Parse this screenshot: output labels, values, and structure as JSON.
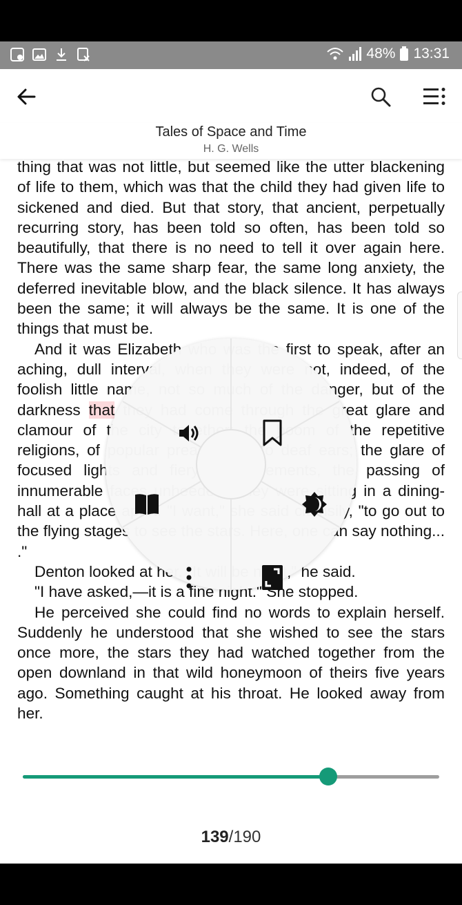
{
  "status_bar": {
    "battery": "48%",
    "time": "13:31"
  },
  "book": {
    "title": "Tales of Space and Time",
    "author": "H. G. Wells"
  },
  "content": {
    "p1": "thing that was not little, but seemed like the utter blackening of life to them, which was that the child they had given life to sickened and died. But that story, that ancient, perpetually recurring story, has been told so often, has been told so beautifully, that there is no need to tell it over again here. There was the same sharp fear, the same long anxiety, the deferred inevitable blow, and the black silence. It has always been the same; it will always be the same. It is one of the things that must be.",
    "p2_a": "And it was Elizabeth who was the first to speak, after an aching, dull interval, when they were not, indeed, of the foolish little name, not so much of the danger, but of the darkness ",
    "p2_hl": "that",
    "p2_b": " they had come through the great glare and clamour of the city together; the boom of the repetitive religions, of popular preachers unto deaf ears; the glare of focused lights and fiery advertisements, the passing of innumerable faces unheeded. They were sitting in a dining-hall at a place apart. \"I want,\" she said clumsily, \"to go out to the flying stages to see the stars. Here, one can say nothing... .\"",
    "p3": "Denton looked at her. \"It will be night,\" he said.",
    "p4": "\"I have asked,—it is a fine night.\" She stopped.",
    "p5": "He perceived she could find no words to explain herself. Suddenly he understood that she wished to see the stars once more, the stars they had watched together from the open downland in that wild honeymoon of theirs five years ago. Something caught at his throat. He looked away from her."
  },
  "radial_menu": {
    "items": [
      {
        "name": "speaker-icon",
        "action": "read-aloud"
      },
      {
        "name": "bookmark-icon",
        "action": "bookmark"
      },
      {
        "name": "book-icon",
        "action": "table-of-contents"
      },
      {
        "name": "brightness-icon",
        "action": "brightness"
      },
      {
        "name": "more-vertical-icon",
        "action": "more"
      },
      {
        "name": "fullscreen-icon",
        "action": "fullscreen"
      }
    ]
  },
  "progress": {
    "fraction": 0.733,
    "current_page": "139",
    "separator_total": "/190"
  },
  "colors": {
    "accent": "#159a78",
    "status_bar": "#8a8a8a",
    "highlight": "#fbd9dc"
  }
}
